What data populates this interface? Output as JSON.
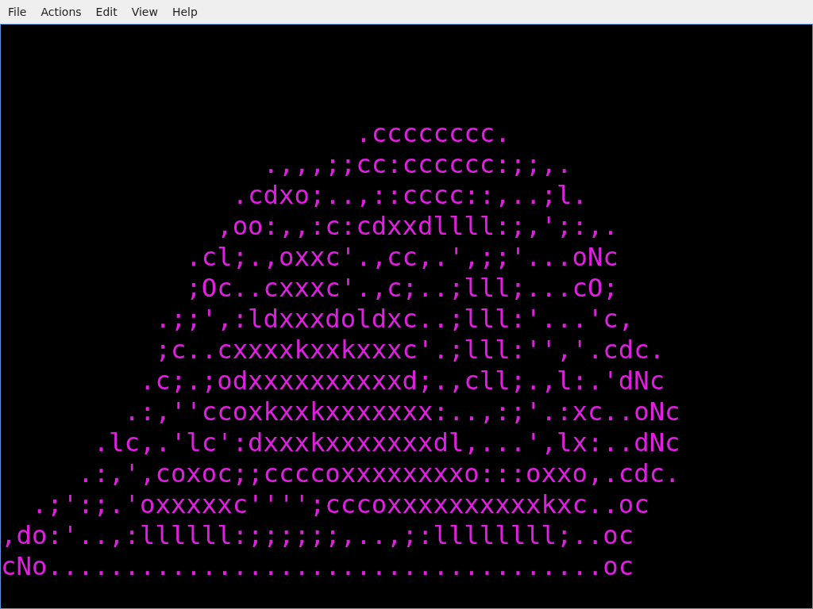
{
  "menu_bar": {
    "items": [
      "File",
      "Actions",
      "Edit",
      "View",
      "Help"
    ]
  },
  "terminal": {
    "lines": [
      "                       .cccccccc.",
      "                 .,,,;;cc:cccccc:;;,.",
      "               .cdxo;..,::cccc::,..;l.",
      "              ,oo:,,:c:cdxxdllll:;,';:,.",
      "            .cl;.,oxxc'.,cc,.',;;'...oNc",
      "            ;Oc..cxxxc'.,c;..;lll;...cO;",
      "          .;;',:ldxxxdoldxc..;lll:'...'c,",
      "          ;c..cxxxxkxxkxxxc'.;lll:'','.cdc.",
      "         .c;.;odxxxxxxxxxxd;.,cll;.,l:.'dNc",
      "        .:,''ccoxkxxkxxxxxxx:..,:;'.:xc..oNc",
      "      .lc,.'lc':dxxxkxxxxxxxdl,...',lx:..dNc",
      "     .:,',coxoc;;ccccoxxxxxxxxo:::oxxo,.cdc.",
      "  .;':;.'oxxxxxc'''';cccoxxxxxxxxxxkxc..oc",
      ",do:'..,:llllll:;;;;;;,..,;:llllllll;..oc",
      "cNo....................................oc"
    ]
  }
}
